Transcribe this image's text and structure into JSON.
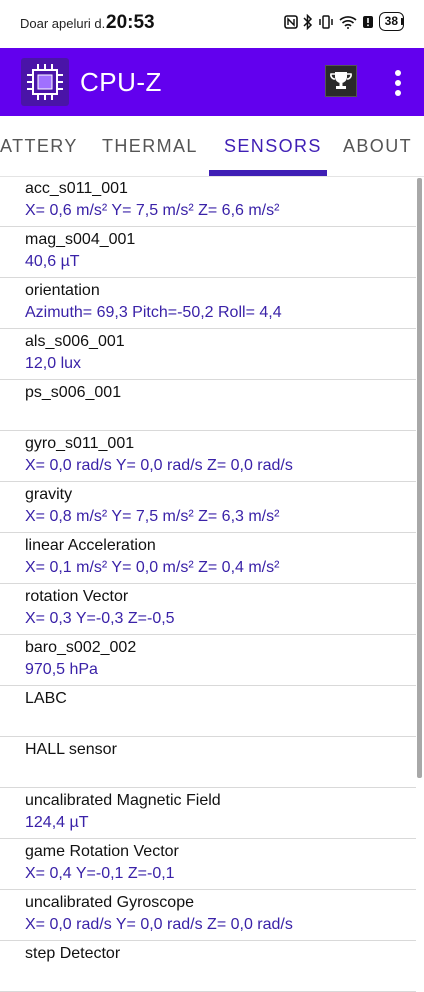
{
  "status_bar": {
    "carrier": "Doar apeluri d...",
    "time": "20:53",
    "battery": "38"
  },
  "app": {
    "title": "CPU-Z",
    "accent": "#6200ee",
    "logo_icon": "cpu-chip-icon",
    "trophy_icon": "trophy-icon",
    "menu_icon": "more-vert-icon"
  },
  "tabs": [
    {
      "label": "ATTERY"
    },
    {
      "label": "THERMAL"
    },
    {
      "label": "SENSORS",
      "active": true
    },
    {
      "label": "ABOUT"
    }
  ],
  "sensors": [
    {
      "name": "acc_s011_001",
      "value": "X= 0,6 m/s²   Y= 7,5 m/s²   Z= 6,6 m/s²"
    },
    {
      "name": "mag_s004_001",
      "value": "40,6 µT"
    },
    {
      "name": "orientation",
      "value": "Azimuth= 69,3   Pitch=-50,2   Roll= 4,4"
    },
    {
      "name": "als_s006_001",
      "value": "12,0 lux"
    },
    {
      "name": "ps_s006_001",
      "value": ""
    },
    {
      "name": "gyro_s011_001",
      "value": "X= 0,0 rad/s   Y= 0,0 rad/s   Z= 0,0 rad/s"
    },
    {
      "name": "gravity",
      "value": "X= 0,8 m/s²   Y= 7,5 m/s²   Z= 6,3 m/s²"
    },
    {
      "name": "linear Acceleration",
      "value": "X= 0,1 m/s²   Y= 0,0 m/s²   Z= 0,4 m/s²"
    },
    {
      "name": "rotation Vector",
      "value": "X= 0,3   Y=-0,3   Z=-0,5"
    },
    {
      "name": "baro_s002_002",
      "value": "970,5 hPa"
    },
    {
      "name": "LABC",
      "value": ""
    },
    {
      "name": "HALL sensor",
      "value": ""
    },
    {
      "name": "uncalibrated Magnetic Field",
      "value": "124,4 µT"
    },
    {
      "name": "game Rotation Vector",
      "value": "X= 0,4   Y=-0,1   Z=-0,1"
    },
    {
      "name": "uncalibrated Gyroscope",
      "value": "X= 0,0 rad/s   Y= 0,0 rad/s   Z= 0,0 rad/s"
    },
    {
      "name": "step Detector",
      "value": ""
    }
  ]
}
